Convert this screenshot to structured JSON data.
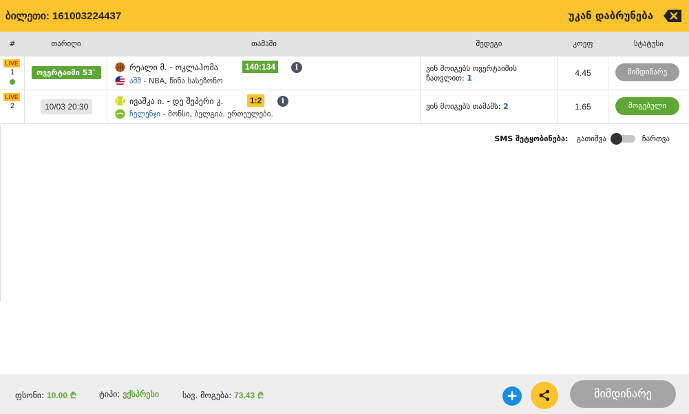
{
  "header": {
    "ticket": "ბილეთი: 161003224437",
    "back_label": "უკან დაბრუნება",
    "back_icon": "backspace-icon",
    "accent_color": "#fcc42c"
  },
  "columns": {
    "num": "#",
    "date": "თარიღი",
    "game": "თამაში",
    "outcome": "შედეგი",
    "odds": "კოეფ",
    "status": "სტატუსი"
  },
  "rows": [
    {
      "live": "LIVE",
      "index": "1",
      "time_label": "ოვერტაიმი 53`",
      "teams": "რეალი მ. - ოკლაჰომა",
      "score": "140:134",
      "sport_icon": "basketball-icon",
      "country_icon": "usa-flag-icon",
      "country": "აშშ",
      "league": " - NBA, წინა სასეზონო",
      "outcome_text": "ვინ მოიგებს ოვერტაიმის ჩათვლით:",
      "outcome_pick": "1",
      "odds": "4.45",
      "status": "მიმდინარე"
    },
    {
      "live": "LIVE",
      "index": "2",
      "time_label": "10/03 20:30",
      "teams": "ივაშკა ი. - დე შეპერი კ.",
      "score": "1:2",
      "sport_icon": "tennis-ball-icon",
      "country_icon": "challenger-icon",
      "country": "ჩელენჯი",
      "league": " - მონსი, ბელგია. ერთეულები.",
      "outcome_text": "ვინ მოიგებს თამაშს:",
      "outcome_pick": "2",
      "odds": "1.65",
      "status": "მოგებული"
    }
  ],
  "sms": {
    "label": "SMS შეტყობინება:",
    "off": "გათიშვა",
    "on": "ჩართვა"
  },
  "footer": {
    "stake_label": "ფსონი:",
    "stake_value": "10.00",
    "type_label": "ტიპი:",
    "type_value": "ექსპრესი",
    "possible_label": "სავ. მოგება:",
    "possible_value": "73.43",
    "plus_label": "+",
    "current_button": "მიმდინარე"
  }
}
